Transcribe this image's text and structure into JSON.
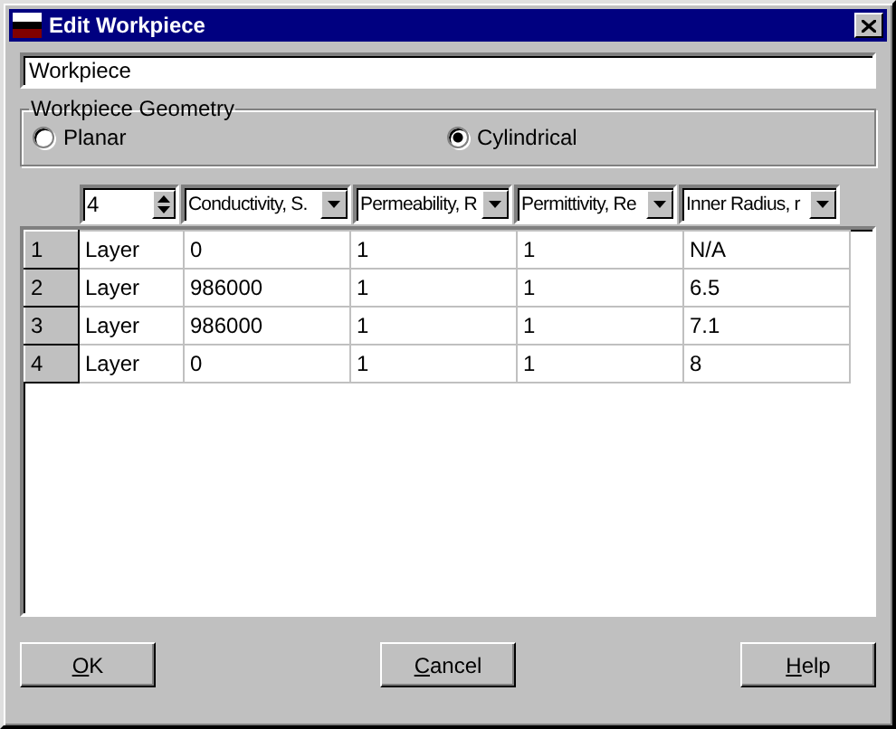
{
  "window": {
    "title": "Edit Workpiece"
  },
  "name_field": {
    "value": "Workpiece"
  },
  "geometry": {
    "label": "Workpiece Geometry",
    "options": [
      {
        "label": "Planar",
        "selected": false
      },
      {
        "label": "Cylindrical",
        "selected": true
      }
    ]
  },
  "layer_count": {
    "value": "4"
  },
  "column_selectors": [
    "Conductivity, S.",
    "Permeability, R",
    "Permittivity, Re",
    "Inner Radius, r"
  ],
  "table": {
    "rows": [
      {
        "number": "1",
        "cells": [
          "Layer",
          "0",
          "1",
          "1",
          "N/A"
        ]
      },
      {
        "number": "2",
        "cells": [
          "Layer",
          "986000",
          "1",
          "1",
          "6.5"
        ]
      },
      {
        "number": "3",
        "cells": [
          "Layer",
          "986000",
          "1",
          "1",
          "7.1"
        ]
      },
      {
        "number": "4",
        "cells": [
          "Layer",
          "0",
          "1",
          "1",
          "8"
        ]
      }
    ]
  },
  "buttons": [
    "OK",
    "Cancel",
    "Help"
  ]
}
